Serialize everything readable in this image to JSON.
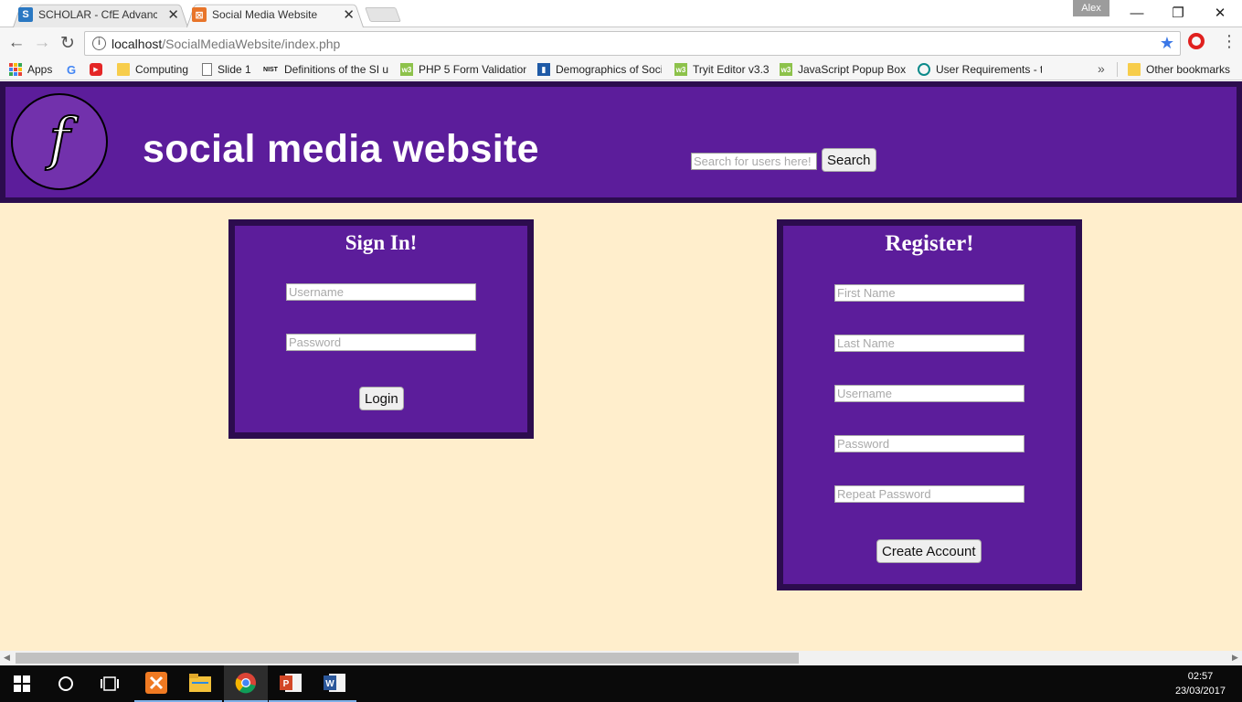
{
  "browser": {
    "tabs": [
      {
        "title": "SCHOLAR - CfE Advanced",
        "favicon": "S",
        "favicon_color": "#2a78c2",
        "close": "✕"
      },
      {
        "title": "Social Media Website",
        "favicon": "⊠",
        "favicon_color": "#e8752a",
        "close": "✕"
      }
    ],
    "user": "Alex",
    "window_controls": {
      "minimize": "—",
      "restore": "❐",
      "close": "✕"
    },
    "url_host": "localhost",
    "url_path": "/SocialMediaWebsite/index.php",
    "bookmarks": [
      {
        "label": "Apps",
        "icon": "apps-icon"
      },
      {
        "label": "",
        "icon": "google-icon"
      },
      {
        "label": "",
        "icon": "youtube-icon"
      },
      {
        "label": "Computing",
        "icon": "folder-icon"
      },
      {
        "label": "Slide 1",
        "icon": "page-icon"
      },
      {
        "label": "Definitions of the SI u",
        "icon": "nist-icon"
      },
      {
        "label": "PHP 5 Form Validation",
        "icon": "w3schools-icon"
      },
      {
        "label": "Demographics of Soci",
        "icon": "chart-icon"
      },
      {
        "label": "Tryit Editor v3.3",
        "icon": "w3schools-icon"
      },
      {
        "label": "JavaScript Popup Boxe",
        "icon": "w3schools-icon"
      },
      {
        "label": "User Requirements - t",
        "icon": "slideshare-icon"
      }
    ],
    "bookmarks_more": "»",
    "other_bookmarks": "Other bookmarks"
  },
  "site": {
    "logo_letter": "f",
    "title": "social media website",
    "search_placeholder": "Search for users here!",
    "search_button": "Search"
  },
  "signin": {
    "title": "Sign In!",
    "username_placeholder": "Username",
    "password_placeholder": "Password",
    "button": "Login"
  },
  "register": {
    "title": "Register!",
    "first_name_placeholder": "First Name",
    "last_name_placeholder": "Last Name",
    "username_placeholder": "Username",
    "password_placeholder": "Password",
    "repeat_password_placeholder": "Repeat Password",
    "button": "Create Account"
  },
  "taskbar": {
    "time": "02:57",
    "date": "23/03/2017"
  },
  "colors": {
    "page_background": "#ffeecc",
    "header_purple": "#5c1d9b",
    "border_dark_purple": "#2c0c4e"
  }
}
